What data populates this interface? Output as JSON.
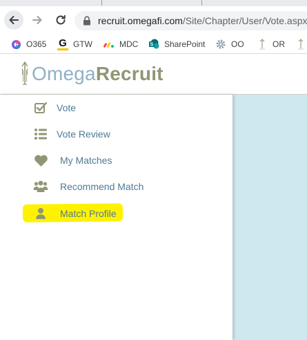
{
  "browser": {
    "url_host": "recruit.omegafi.com",
    "url_path": "/Site/Chapter/User/Vote.aspx",
    "bookmarks": [
      {
        "label": "O365",
        "icon": "office365-icon"
      },
      {
        "label": "GTW",
        "icon": "gotowebinar-icon"
      },
      {
        "label": "MDC",
        "icon": "monday-icon"
      },
      {
        "label": "SharePoint",
        "icon": "sharepoint-icon"
      },
      {
        "label": "OO",
        "icon": "gear-icon"
      },
      {
        "label": "OR",
        "icon": "omegarecruit-bookmark-icon"
      }
    ]
  },
  "app": {
    "logo_part1": "Omega",
    "logo_part2": "Recruit",
    "colors": {
      "omega": "#8fb0c6",
      "recruit": "#8f9674",
      "menu_text": "#4f7a94",
      "icon": "#8f9674",
      "content_bg": "#cde8ef",
      "highlight": "#fff200"
    }
  },
  "sidebar": {
    "items": [
      {
        "label": "Vote",
        "icon": "checkbox-icon"
      },
      {
        "label": "Vote Review",
        "icon": "list-icon"
      },
      {
        "label": "My Matches",
        "icon": "heart-icon"
      },
      {
        "label": "Recommend Match",
        "icon": "users-icon"
      },
      {
        "label": "Match Profile",
        "icon": "user-icon",
        "highlighted": true
      }
    ]
  }
}
